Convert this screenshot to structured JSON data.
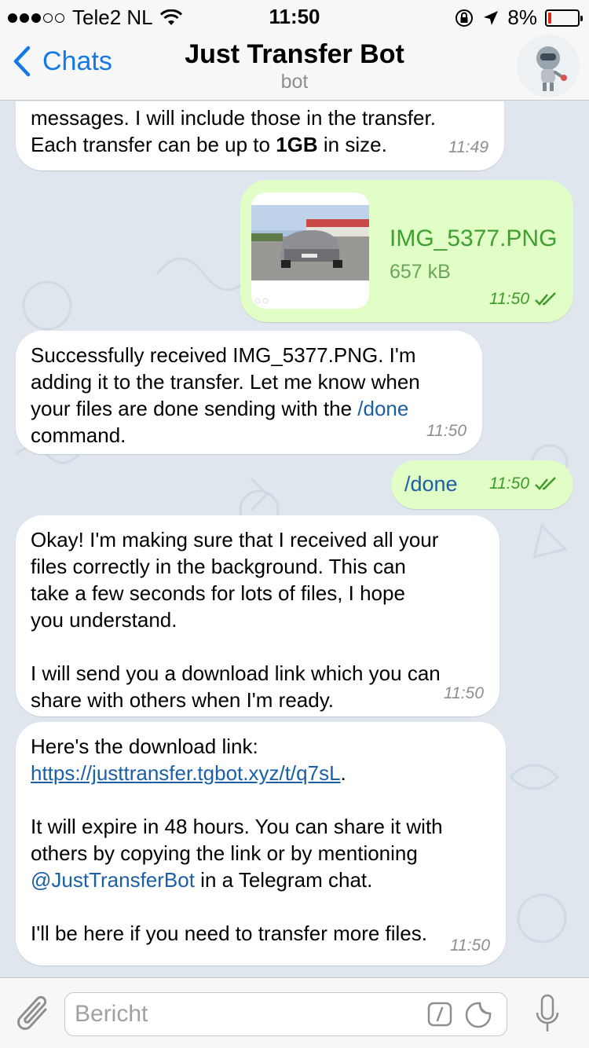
{
  "status_bar": {
    "carrier": "Tele2 NL",
    "time": "11:50",
    "battery": "8%"
  },
  "nav": {
    "back_label": "Chats",
    "title": "Just Transfer Bot",
    "subtitle": "bot"
  },
  "messages": [
    {
      "direction": "in",
      "line1": "messages. I will include those in the transfer.",
      "line2_pre": "Each transfer can be up to ",
      "line2_bold": "1GB",
      "line2_post": " in size.",
      "time": "11:49"
    },
    {
      "direction": "out",
      "file_name": "IMG_5377.PNG",
      "file_size": "657 kB",
      "time": "11:50"
    },
    {
      "direction": "in",
      "text": "Successfully received IMG_5377.PNG. I'm\nadding it to the transfer. Let me know when\nyour files are done sending with the ",
      "command": "/done",
      "text_after": "\ncommand.",
      "time": "11:50"
    },
    {
      "direction": "out",
      "text": "/done",
      "time": "11:50"
    },
    {
      "direction": "in",
      "text": "Okay! I'm making sure that I received all your\nfiles correctly in the background. This can\ntake a few seconds for lots of files, I hope\nyou understand.\n\nI will send you a download link which you can\nshare with others when I'm ready.",
      "time": "11:50"
    },
    {
      "direction": "in",
      "text_intro": "Here's the download link:",
      "link": "https://justtransfer.tgbot.xyz/t/q7sL",
      "link_after": ".",
      "text_mid": "It will expire in 48 hours. You can share it with\nothers by copying the link or by mentioning",
      "mention": "@JustTransferBot",
      "mention_after": " in a Telegram chat.",
      "text_end": "I'll be here if you need to transfer more files.",
      "time": "11:50"
    }
  ],
  "input": {
    "placeholder": "Bericht"
  },
  "colors": {
    "accent": "#1479e6",
    "incoming_bubble": "#ffffff",
    "outgoing_bubble": "#e1fec6",
    "outgoing_meta": "#3f9a2c",
    "link": "#1a5fa7",
    "chat_background": "#dfe6ee"
  },
  "icons": [
    "wifi-icon",
    "lock-rotation-icon",
    "location-arrow-icon",
    "battery-icon",
    "back-chevron-icon",
    "read-checks-icon",
    "paperclip-icon",
    "command-icon",
    "sticker-icon",
    "microphone-icon"
  ]
}
